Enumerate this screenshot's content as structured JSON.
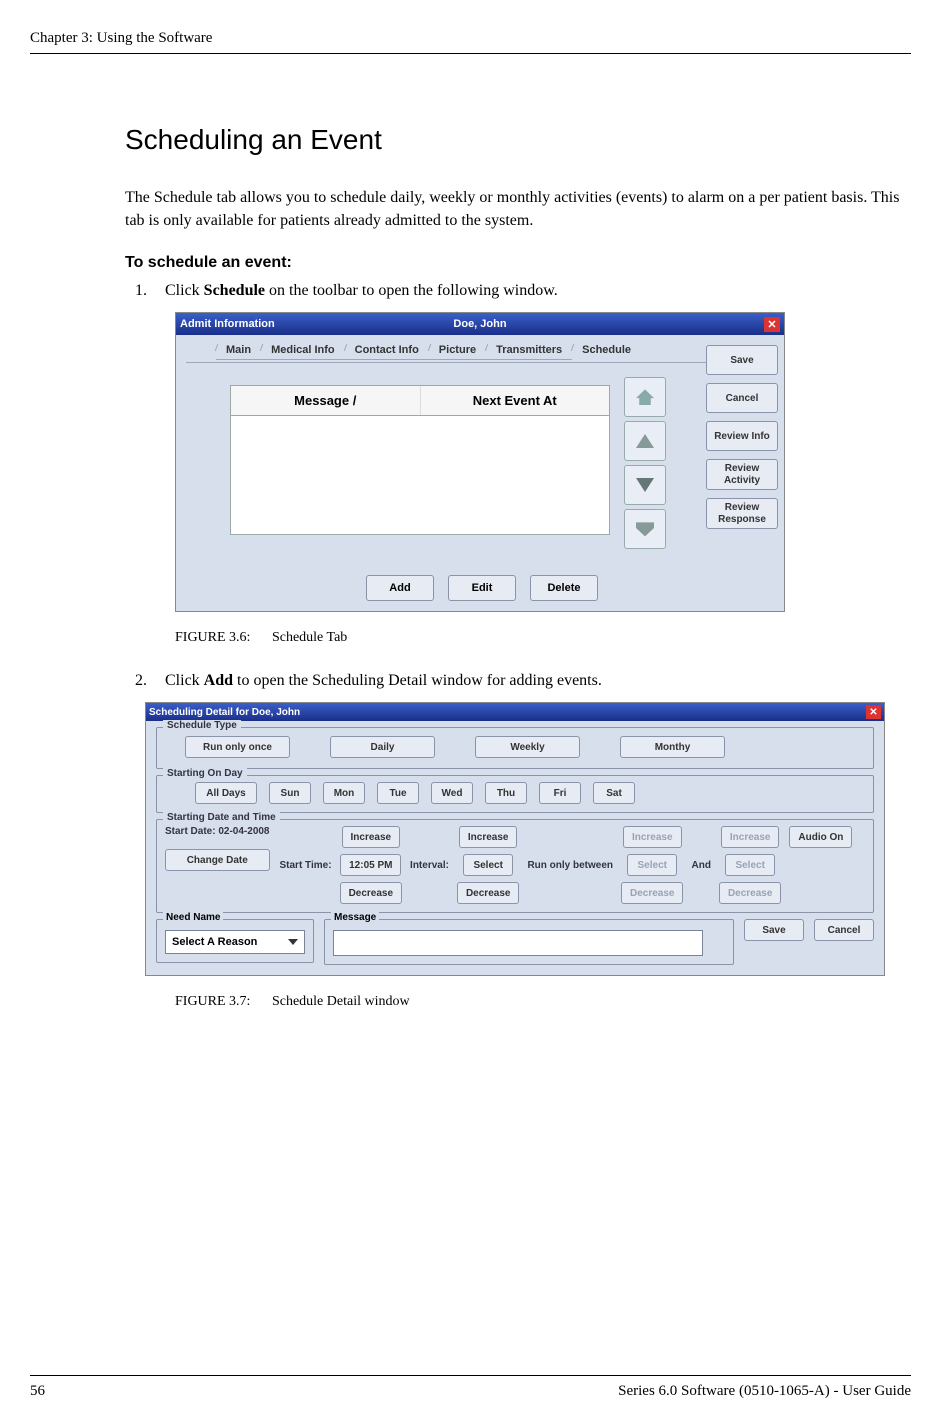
{
  "header": {
    "chapter": "Chapter 3: Using the Software"
  },
  "section": {
    "title": "Scheduling an Event",
    "intro": "The Schedule tab allows you to schedule daily, weekly or monthly activities (events) to alarm on a per patient basis. This tab is only available for patients already admitted to the system.",
    "subheading": "To schedule an event:"
  },
  "steps": {
    "s1_num": "1.",
    "s1_pre": "Click ",
    "s1_bold": "Schedule",
    "s1_post": " on the toolbar to open the following window.",
    "s2_num": "2.",
    "s2_pre": "Click ",
    "s2_bold": "Add",
    "s2_post": " to open the Scheduling Detail window for adding events."
  },
  "fig1": {
    "label": "FIGURE 3.6:",
    "caption": "Schedule Tab"
  },
  "fig2": {
    "label": "FIGURE 3.7:",
    "caption": "Schedule Detail window"
  },
  "win1": {
    "title_left": "Admit Information",
    "title_center": "Doe, John",
    "tabs": {
      "main": "Main",
      "medical": "Medical Info",
      "contact": "Contact Info",
      "picture": "Picture",
      "transmitters": "Transmitters",
      "schedule": "Schedule"
    },
    "grid": {
      "col1": "Message  /",
      "col2": "Next Event At"
    },
    "side": {
      "save": "Save",
      "cancel": "Cancel",
      "review_info": "Review Info",
      "review_activity": "Review Activity",
      "review_response": "Review Response"
    },
    "bottom": {
      "add": "Add",
      "edit": "Edit",
      "delete": "Delete"
    }
  },
  "win2": {
    "title": "Scheduling Detail for Doe, John",
    "groups": {
      "schedule_type": "Schedule Type",
      "starting_on_day": "Starting On Day",
      "starting_date_time": "Starting Date and Time",
      "need_name": "Need Name",
      "message": "Message"
    },
    "type": {
      "once": "Run only once",
      "daily": "Daily",
      "weekly": "Weekly",
      "monthly": "Monthy"
    },
    "days": {
      "all": "All Days",
      "sun": "Sun",
      "mon": "Mon",
      "tue": "Tue",
      "wed": "Wed",
      "thu": "Thu",
      "fri": "Fri",
      "sat": "Sat"
    },
    "start": {
      "start_date": "Start Date: 02-04-2008",
      "change_date": "Change Date",
      "start_time_label": "Start Time:",
      "start_time_value": "12:05 PM",
      "interval_label": "Interval:",
      "increase": "Increase",
      "decrease": "Decrease",
      "select": "Select",
      "run_only_between": "Run only between",
      "and": "And",
      "audio_on": "Audio On"
    },
    "need": {
      "select_reason": "Select A Reason"
    },
    "footer": {
      "save": "Save",
      "cancel": "Cancel"
    }
  },
  "footer": {
    "page": "56",
    "doc": "Series 6.0 Software (0510-1065-A) - User Guide"
  }
}
